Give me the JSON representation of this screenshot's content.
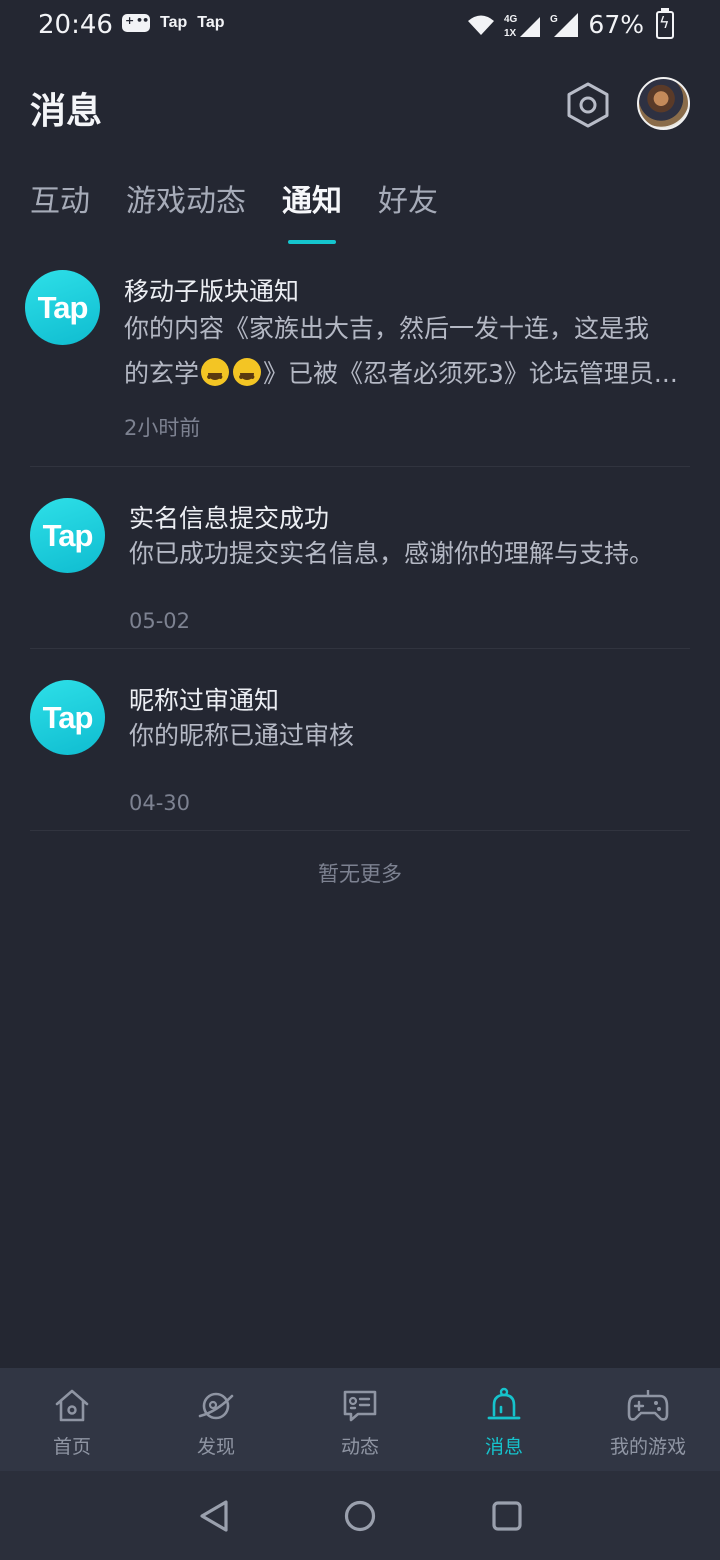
{
  "status_bar": {
    "time": "20:46",
    "notif_labels": [
      "Tap",
      "Tap"
    ],
    "network": "4G",
    "battery": "67%"
  },
  "header": {
    "title": "消息"
  },
  "tabs": [
    {
      "label": "互动",
      "active": false
    },
    {
      "label": "游戏动态",
      "active": false
    },
    {
      "label": "通知",
      "active": true
    },
    {
      "label": "好友",
      "active": false
    }
  ],
  "notifications": [
    {
      "logo": "Tap",
      "title": "移动子版块通知",
      "body_line1": "你的内容《家族出大吉，然后一发十连，这是我",
      "body_line2_prefix": "的玄学",
      "body_line2_suffix": "》已被《忍者必须死3》论坛管理员...",
      "time": "2小时前"
    },
    {
      "logo": "Tap",
      "title": "实名信息提交成功",
      "body": "你已成功提交实名信息，感谢你的理解与支持。",
      "time": "05-02"
    },
    {
      "logo": "Tap",
      "title": "昵称过审通知",
      "body": "你的昵称已通过审核",
      "time": "04-30"
    }
  ],
  "no_more": "暂无更多",
  "bottom_nav": [
    {
      "label": "首页",
      "icon": "home-icon"
    },
    {
      "label": "发现",
      "icon": "planet-icon"
    },
    {
      "label": "动态",
      "icon": "chat-card-icon"
    },
    {
      "label": "消息",
      "icon": "bell-icon",
      "active": true
    },
    {
      "label": "我的游戏",
      "icon": "gamepad-icon"
    }
  ],
  "colors": {
    "accent": "#16c3cc",
    "background": "#242732",
    "nav_bg": "#313644"
  }
}
